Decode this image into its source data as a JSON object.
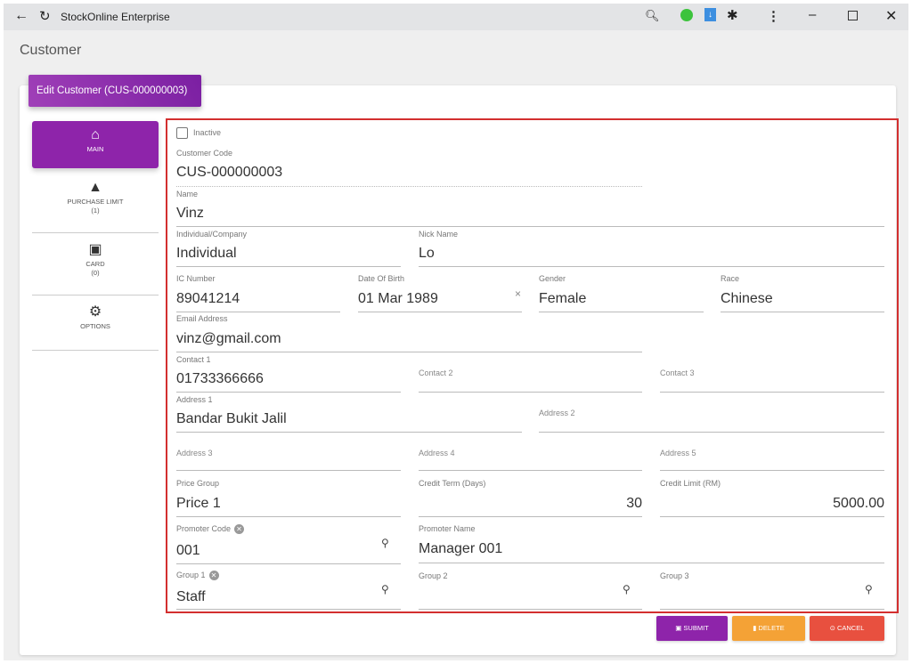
{
  "window": {
    "title": "StockOnline Enterprise"
  },
  "page": {
    "title": "Customer",
    "card_header": "Edit Customer (CUS-000000003)"
  },
  "sidebar": {
    "items": [
      {
        "label": "MAIN",
        "count": ""
      },
      {
        "label": "PURCHASE LIMIT",
        "count": "(1)"
      },
      {
        "label": "CARD",
        "count": "(0)"
      },
      {
        "label": "OPTIONS",
        "count": ""
      }
    ]
  },
  "form": {
    "inactive": {
      "label": "Inactive",
      "checked": false
    },
    "customer_code": {
      "label": "Customer Code",
      "value": "CUS-000000003"
    },
    "name": {
      "label": "Name",
      "value": "Vinz"
    },
    "individual_company": {
      "label": "Individual/Company",
      "value": "Individual"
    },
    "nick_name": {
      "label": "Nick Name",
      "value": "Lo"
    },
    "ic_number": {
      "label": "IC Number",
      "value": "89041214"
    },
    "dob": {
      "label": "Date Of Birth",
      "value": "01 Mar 1989"
    },
    "gender": {
      "label": "Gender",
      "value": "Female"
    },
    "race": {
      "label": "Race",
      "value": "Chinese"
    },
    "email": {
      "label": "Email Address",
      "value": "vinz@gmail.com"
    },
    "contact1": {
      "label": "Contact 1",
      "value": "01733366666"
    },
    "contact2": {
      "label": "Contact 2"
    },
    "contact3": {
      "label": "Contact 3"
    },
    "address1": {
      "label": "Address 1",
      "value": "Bandar Bukit Jalil"
    },
    "address2": {
      "label": "Address 2"
    },
    "address3": {
      "label": "Address 3"
    },
    "address4": {
      "label": "Address 4"
    },
    "address5": {
      "label": "Address 5"
    },
    "price_group": {
      "label": "Price Group",
      "value": "Price 1"
    },
    "credit_term": {
      "label": "Credit Term (Days)",
      "value": "30"
    },
    "credit_limit": {
      "label": "Credit Limit (RM)",
      "value": "5000.00"
    },
    "promoter_code": {
      "label": "Promoter Code",
      "value": "001"
    },
    "promoter_name": {
      "label": "Promoter Name",
      "value": "Manager 001"
    },
    "group1": {
      "label": "Group 1",
      "value": "Staff"
    },
    "group2": {
      "label": "Group 2"
    },
    "group3": {
      "label": "Group 3"
    }
  },
  "buttons": {
    "submit": "SUBMIT",
    "delete": "DELETE",
    "cancel": "CANCEL"
  },
  "colors": {
    "primary": "#8e24aa",
    "warning": "#f4a236",
    "danger": "#e8503f",
    "highlight": "#d32f2f"
  }
}
